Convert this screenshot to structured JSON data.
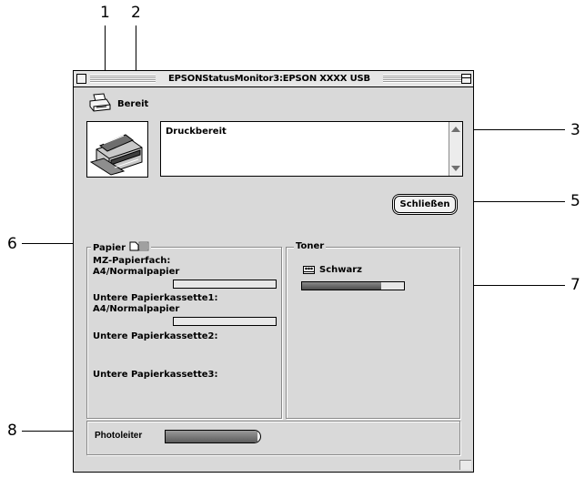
{
  "callouts": {
    "n1": "1",
    "n2": "2",
    "n3": "3",
    "n5": "5",
    "n6": "6",
    "n7": "7",
    "n8": "8"
  },
  "window": {
    "title": "EPSONStatusMonitor3:EPSON XXXX USB"
  },
  "status": {
    "label": "Bereit",
    "icon": "printer-icon",
    "message": "Druckbereit"
  },
  "buttons": {
    "close_label": "Schließen"
  },
  "paper": {
    "title": "Papier",
    "sources": [
      {
        "name": "MZ-Papierfach:",
        "media": "A4/Normalpapier",
        "has_bar": true
      },
      {
        "name": "Untere Papierkassette1:",
        "media": "A4/Normalpapier",
        "has_bar": true
      },
      {
        "name": "Untere Papierkassette2:",
        "media": "",
        "has_bar": false
      },
      {
        "name": "Untere Papierkassette3:",
        "media": "",
        "has_bar": false
      }
    ]
  },
  "toner": {
    "title": "Toner",
    "color_name": "Schwarz",
    "level_fraction": 0.78
  },
  "photoconductor": {
    "label": "Photoleiter",
    "level_fraction": 0.97
  }
}
